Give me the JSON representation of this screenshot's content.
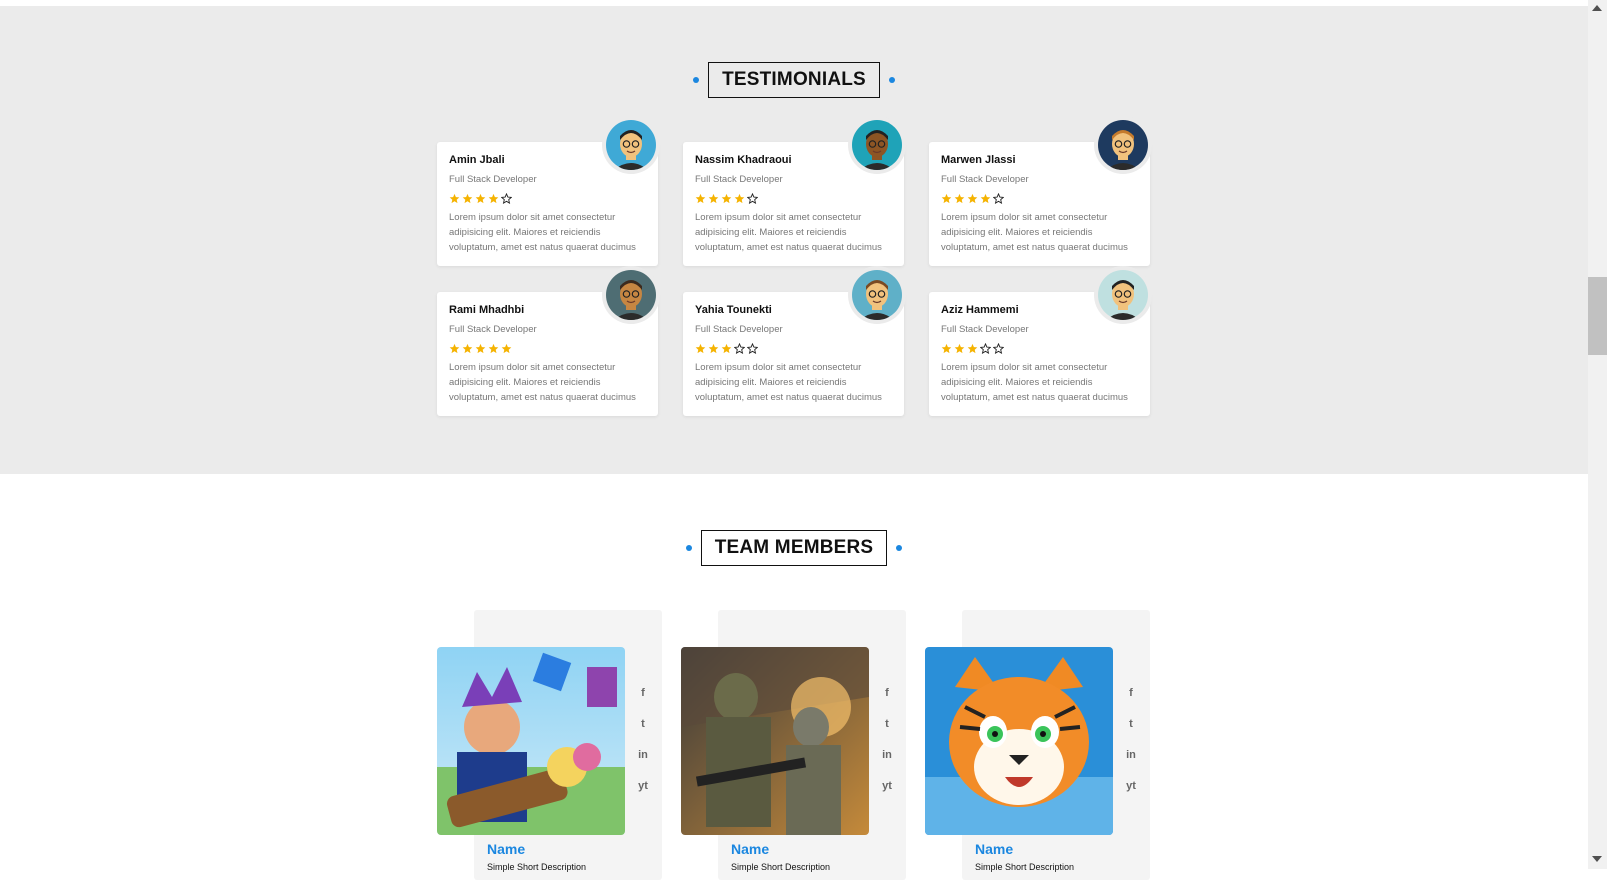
{
  "testimonials": {
    "title": "TESTIMONIALS",
    "items": [
      {
        "name": "Amin Jbali",
        "role": "Full Stack Developer",
        "rating": 4,
        "text": "Lorem ipsum dolor sit amet consectetur adipisicing elit. Maiores et reiciendis voluptatum, amet est natus quaerat ducimus",
        "avatar": "bearded-man-glasses-avatar"
      },
      {
        "name": "Nassim Khadraoui",
        "role": "Full Stack Developer",
        "rating": 4,
        "text": "Lorem ipsum dolor sit amet consectetur adipisicing elit. Maiores et reiciendis voluptatum, amet est natus quaerat ducimus",
        "avatar": "man-sunglasses-avatar"
      },
      {
        "name": "Marwen Jlassi",
        "role": "Full Stack Developer",
        "rating": 4,
        "text": "Lorem ipsum dolor sit amet consectetur adipisicing elit. Maiores et reiciendis voluptatum, amet est natus quaerat ducimus",
        "avatar": "man-glasses-avatar"
      },
      {
        "name": "Rami Mhadhbi",
        "role": "Full Stack Developer",
        "rating": 5,
        "text": "Lorem ipsum dolor sit amet consectetur adipisicing elit. Maiores et reiciendis voluptatum, amet est natus quaerat ducimus",
        "avatar": "man-pink-glasses-avatar"
      },
      {
        "name": "Yahia Tounekti",
        "role": "Full Stack Developer",
        "rating": 3,
        "text": "Lorem ipsum dolor sit amet consectetur adipisicing elit. Maiores et reiciendis voluptatum, amet est natus quaerat ducimus",
        "avatar": "bearded-man-avatar"
      },
      {
        "name": "Aziz Hammemi",
        "role": "Full Stack Developer",
        "rating": 3,
        "text": "Lorem ipsum dolor sit amet consectetur adipisicing elit. Maiores et reiciendis voluptatum, amet est natus quaerat ducimus",
        "avatar": "man-dark-glasses-avatar"
      }
    ]
  },
  "team": {
    "title": "TEAM MEMBERS",
    "members": [
      {
        "name": "Name",
        "description": "Simple Short Description",
        "image": "cartoon-hero-bazooka-image"
      },
      {
        "name": "Name",
        "description": "Simple Short Description",
        "image": "soldiers-game-image"
      },
      {
        "name": "Name",
        "description": "Simple Short Description",
        "image": "cartoon-tiger-image"
      }
    ],
    "socials": [
      "f",
      "t",
      "in",
      "yt"
    ]
  },
  "colors": {
    "accent": "#1b87e0",
    "star": "#f5b301",
    "section_bg": "#ebebeb"
  }
}
